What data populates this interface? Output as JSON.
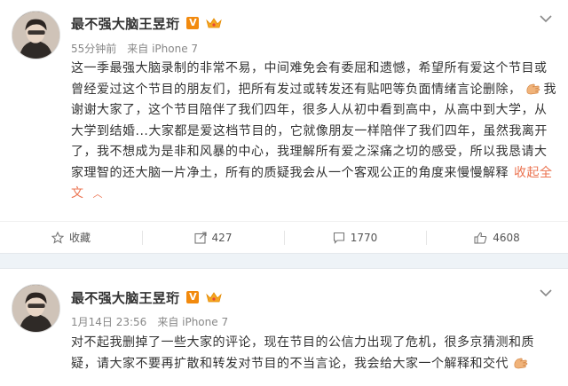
{
  "posts": [
    {
      "author": "最不强大脑王昱珩",
      "verified_badge": "V",
      "meta": {
        "time": "55分钟前",
        "source": "来自 iPhone 7"
      },
      "text": {
        "line1": "这一季最强大脑录制的非常不易，中间难免会有委屈和遗憾，希望所有爱这个节目或曾经爱过这个节目的朋友们，把所有发过或转发还有贴吧等负面情绪言论删除，",
        "line2": "我谢谢大家了，这个节目陪伴了我们四年，很多人从初中看到高中，从高中到大学，从大学到结婚...大家都是爱这档节目的，它就像朋友一样陪伴了我们四年，虽然我离开了，我不想成为是非和风暴的中心，我理解所有爱之深痛之切的感受，所以我恳请大家理智的还大脑一片净土，所有的质疑我会从一个客观公正的角度来慢慢解释"
      },
      "collapse_label": "收起全文",
      "actions": {
        "favorite": "收藏",
        "repost": "427",
        "comment": "1770",
        "like": "4608"
      }
    },
    {
      "author": "最不强大脑王昱珩",
      "verified_badge": "V",
      "meta": {
        "time": "1月14日 23:56",
        "source": "来自 iPhone 7"
      },
      "text": {
        "body": "对不起我删掉了一些大家的评论，现在节目的公信力出现了危机，很多京猜测和质疑，请大家不要再扩散和转发对节目的不当言论，我会给大家一个解释和交代"
      }
    }
  ],
  "colors": {
    "accent": "#eb7350",
    "badge": "#f28a0e",
    "divider_bg": "#eef3f7"
  },
  "icons": [
    "chevron-down-icon",
    "star-icon",
    "repost-icon",
    "comment-icon",
    "like-icon",
    "clap-emoji-icon",
    "crown-icon"
  ]
}
